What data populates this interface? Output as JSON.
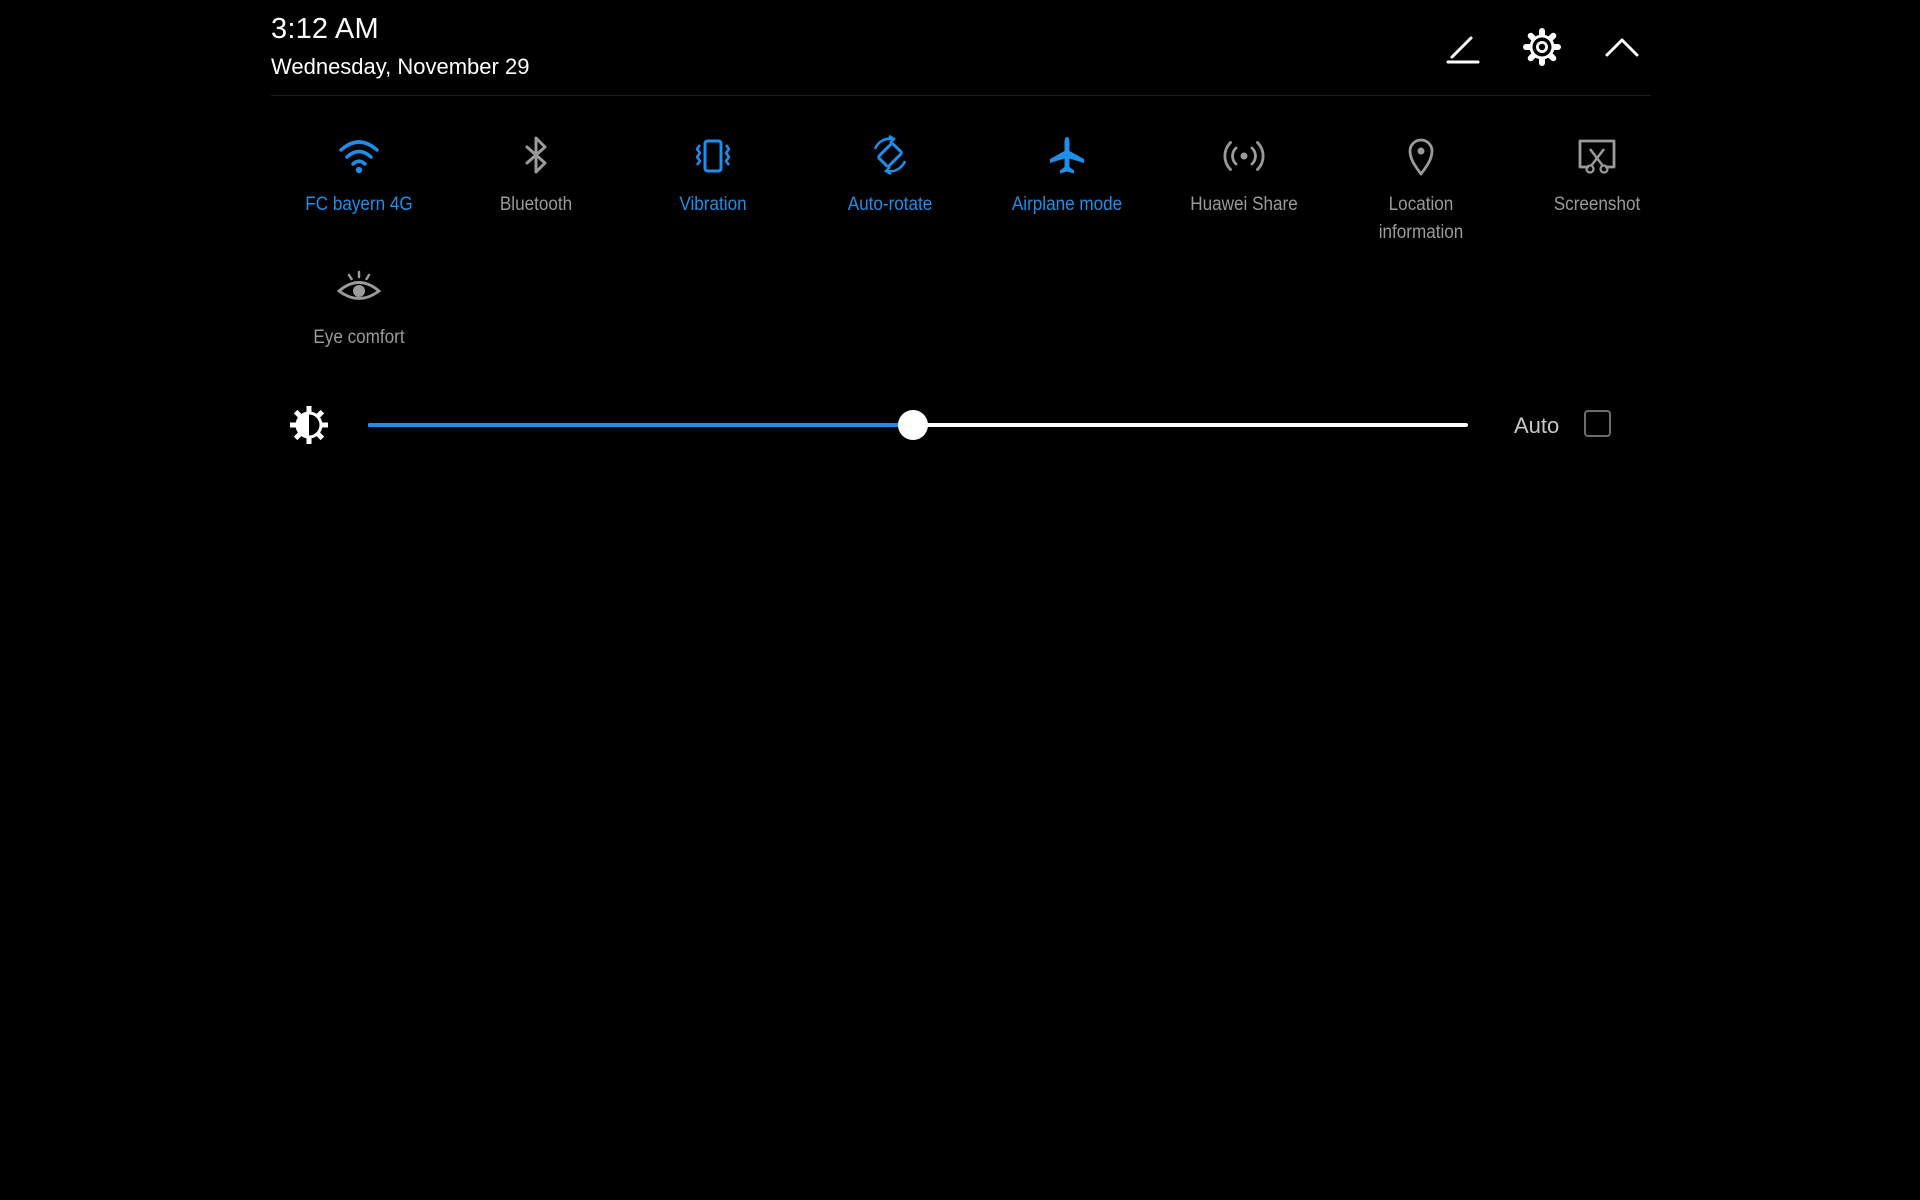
{
  "header": {
    "time": "3:12 AM",
    "date": "Wednesday, November 29",
    "actions": [
      {
        "name": "edit-button",
        "icon": "pencil-icon"
      },
      {
        "name": "settings-button",
        "icon": "gear-icon"
      },
      {
        "name": "collapse-button",
        "icon": "chevron-up-icon"
      }
    ]
  },
  "quick_settings": {
    "tiles": [
      {
        "label": "FC bayern 4G",
        "icon": "wifi-icon",
        "active": true
      },
      {
        "label": "Bluetooth",
        "icon": "bluetooth-icon",
        "active": false
      },
      {
        "label": "Vibration",
        "icon": "vibration-icon",
        "active": true
      },
      {
        "label": "Auto-rotate",
        "icon": "auto-rotate-icon",
        "active": true
      },
      {
        "label": "Airplane mode",
        "icon": "airplane-icon",
        "active": true
      },
      {
        "label": "Huawei Share",
        "icon": "huawei-share-icon",
        "active": false
      },
      {
        "label": "Location information",
        "icon": "location-pin-icon",
        "active": false
      },
      {
        "label": "Screenshot",
        "icon": "screenshot-icon",
        "active": false
      },
      {
        "label": "Eye comfort",
        "icon": "eye-icon",
        "active": false
      }
    ]
  },
  "brightness": {
    "icon": "brightness-icon",
    "level": 0.495,
    "auto_label": "Auto",
    "auto_checked": false
  },
  "colors": {
    "background": "#000000",
    "accent": "#1e8ee8",
    "inactive": "#9a9a9a",
    "text": "#ffffff"
  }
}
